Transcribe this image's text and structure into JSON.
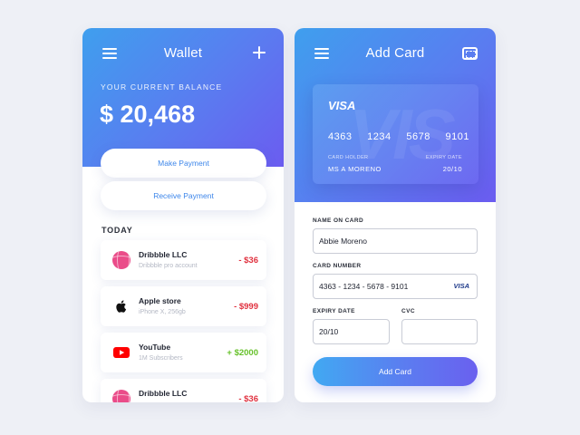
{
  "wallet": {
    "title": "Wallet",
    "balance_label": "YOUR CURRENT BALANCE",
    "balance": "$ 20,468",
    "make_payment": "Make Payment",
    "receive_payment": "Receive Payment",
    "section_title": "TODAY",
    "transactions": [
      {
        "name": "Dribbble LLC",
        "sub": "Dribbble pro account",
        "amount": "- $36",
        "icon": "dribbble-icon"
      },
      {
        "name": "Apple store",
        "sub": "iPhone X, 256gb",
        "amount": "- $999",
        "icon": "apple-icon"
      },
      {
        "name": "YouTube",
        "sub": "1M Subscribers",
        "amount": "+ $2000",
        "icon": "youtube-icon"
      },
      {
        "name": "Dribbble LLC",
        "sub": "",
        "amount": "- $36",
        "icon": "dribbble-icon"
      }
    ]
  },
  "add_card": {
    "title": "Add Card",
    "card": {
      "brand": "VISA",
      "watermark": "VIS",
      "number_groups": [
        "4363",
        "1234",
        "5678",
        "9101"
      ],
      "holder_label": "CARD HOLDER",
      "holder": "MS A MORENO",
      "expiry_label": "EXPIRY DATE",
      "expiry": "20/10"
    },
    "form": {
      "name_label": "NAME ON CARD",
      "name_value": "Abbie Moreno",
      "number_label": "CARD NUMBER",
      "number_value": "4363 - 1234 - 5678 - 9101",
      "number_brand": "VISA",
      "expiry_label": "EXPIRY DATE",
      "expiry_value": "20/10",
      "cvc_label": "CVC",
      "cvc_value": ""
    },
    "submit": "Add Card"
  },
  "colors": {
    "background": "#eef0f6",
    "gradient_start": "#3f9fee",
    "gradient_end": "#6b5cf0",
    "accent_text": "#3d86ea",
    "negative": "#e0313f",
    "positive": "#66c12a"
  }
}
